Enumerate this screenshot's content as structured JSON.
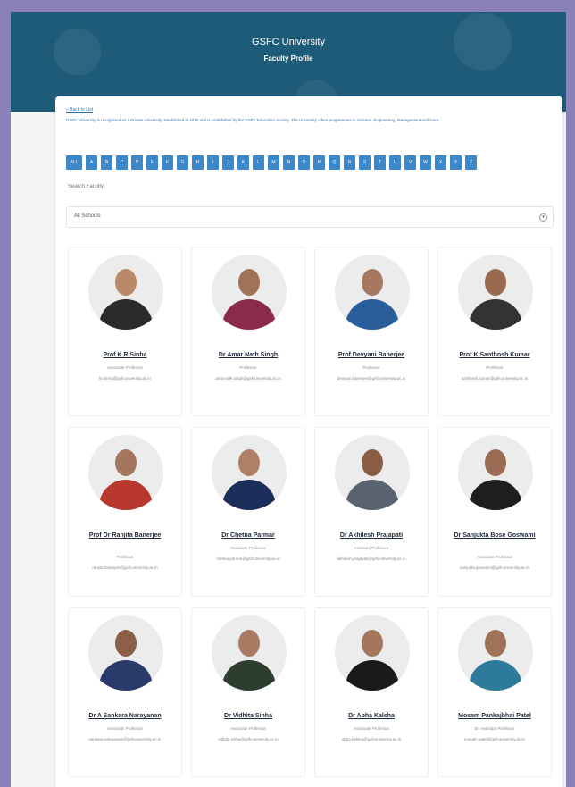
{
  "hero": {
    "title": "GSFC University",
    "subtitle": "Faculty Profile"
  },
  "back_link": "« Back to List",
  "description": "GSFC University is recognised as a Private University, established in 2015 and is established by the GSFC Education Society. The University offers programmes in Science, Engineering, Management and more.",
  "alphabet": [
    "ALL",
    "A",
    "B",
    "C",
    "D",
    "E",
    "F",
    "G",
    "H",
    "I",
    "J",
    "K",
    "L",
    "M",
    "N",
    "O",
    "P",
    "Q",
    "R",
    "S",
    "T",
    "U",
    "V",
    "W",
    "X",
    "Y",
    "Z"
  ],
  "search": {
    "placeholder": "Search Faculty"
  },
  "filter": {
    "label": "All Schools"
  },
  "faculty": [
    {
      "name": "Prof K R Sinha",
      "designation": "Associate Professor",
      "email": "kr.sinha@gsfcuniversity.ac.in",
      "skin": "#b88a6a",
      "shirt": "#2b2b2b"
    },
    {
      "name": "Dr Amar Nath Singh",
      "designation": "Professor",
      "email": "amarnath.singh@gsfcuniversity.ac.in",
      "skin": "#a0725a",
      "shirt": "#8a2b4a"
    },
    {
      "name": "Prof Devyani Banerjee",
      "designation": "Professor",
      "email": "devyani.banerjee@gsfcuniversity.ac.in",
      "skin": "#a67860",
      "shirt": "#2a5e9a"
    },
    {
      "name": "Prof K Santhosh Kumar",
      "designation": "Professor",
      "email": "santhosh.kumar@gsfcuniversity.ac.in",
      "skin": "#9a6a50",
      "shirt": "#333333"
    },
    {
      "name": "Prof Dr Ranjita Banerjee",
      "designation": "Professor",
      "email": "ranjita.banerjee@gsfcuniversity.ac.in",
      "skin": "#a5765e",
      "shirt": "#b8382e"
    },
    {
      "name": "Dr Chetna Parmar",
      "designation": "Associate Professor",
      "email": "chetna.parmar@gsfcuniversity.ac.in",
      "skin": "#b08066",
      "shirt": "#1c2e5a"
    },
    {
      "name": "Dr Akhilesh Prajapati",
      "designation": "Assistant Professor",
      "email": "akhilesh.prajapati@gsfcuniversity.ac.in",
      "skin": "#8a5e44",
      "shirt": "#5a6470"
    },
    {
      "name": "Dr Sanjukta Bose Goswami",
      "designation": "Associate Professor",
      "email": "sanjukta.goswami@gsfcuniversity.ac.in",
      "skin": "#9a6c54",
      "shirt": "#1e1e1e"
    },
    {
      "name": "Dr A Sankara Narayanan",
      "designation": "Associate Professor",
      "email": "sankara.narayanan@gsfcuniversity.ac.in",
      "skin": "#8a6048",
      "shirt": "#2a3a6a"
    },
    {
      "name": "Dr Vidhita Sinha",
      "designation": "Associate Professor",
      "email": "vidhita.sinha@gsfcuniversity.ac.in",
      "skin": "#a87a62",
      "shirt": "#2e3e2e"
    },
    {
      "name": "Dr Abha Kalsha",
      "designation": "Associate Professor",
      "email": "abha.kalsha@gsfcuniversity.ac.in",
      "skin": "#a5765e",
      "shirt": "#1a1a1a"
    },
    {
      "name": "Mosam Pankajbhai Patel",
      "designation": "Sr. Assistant Professor",
      "email": "mosam.patel@gsfcuniversity.ac.in",
      "skin": "#a0725a",
      "shirt": "#2e7a9a"
    }
  ]
}
